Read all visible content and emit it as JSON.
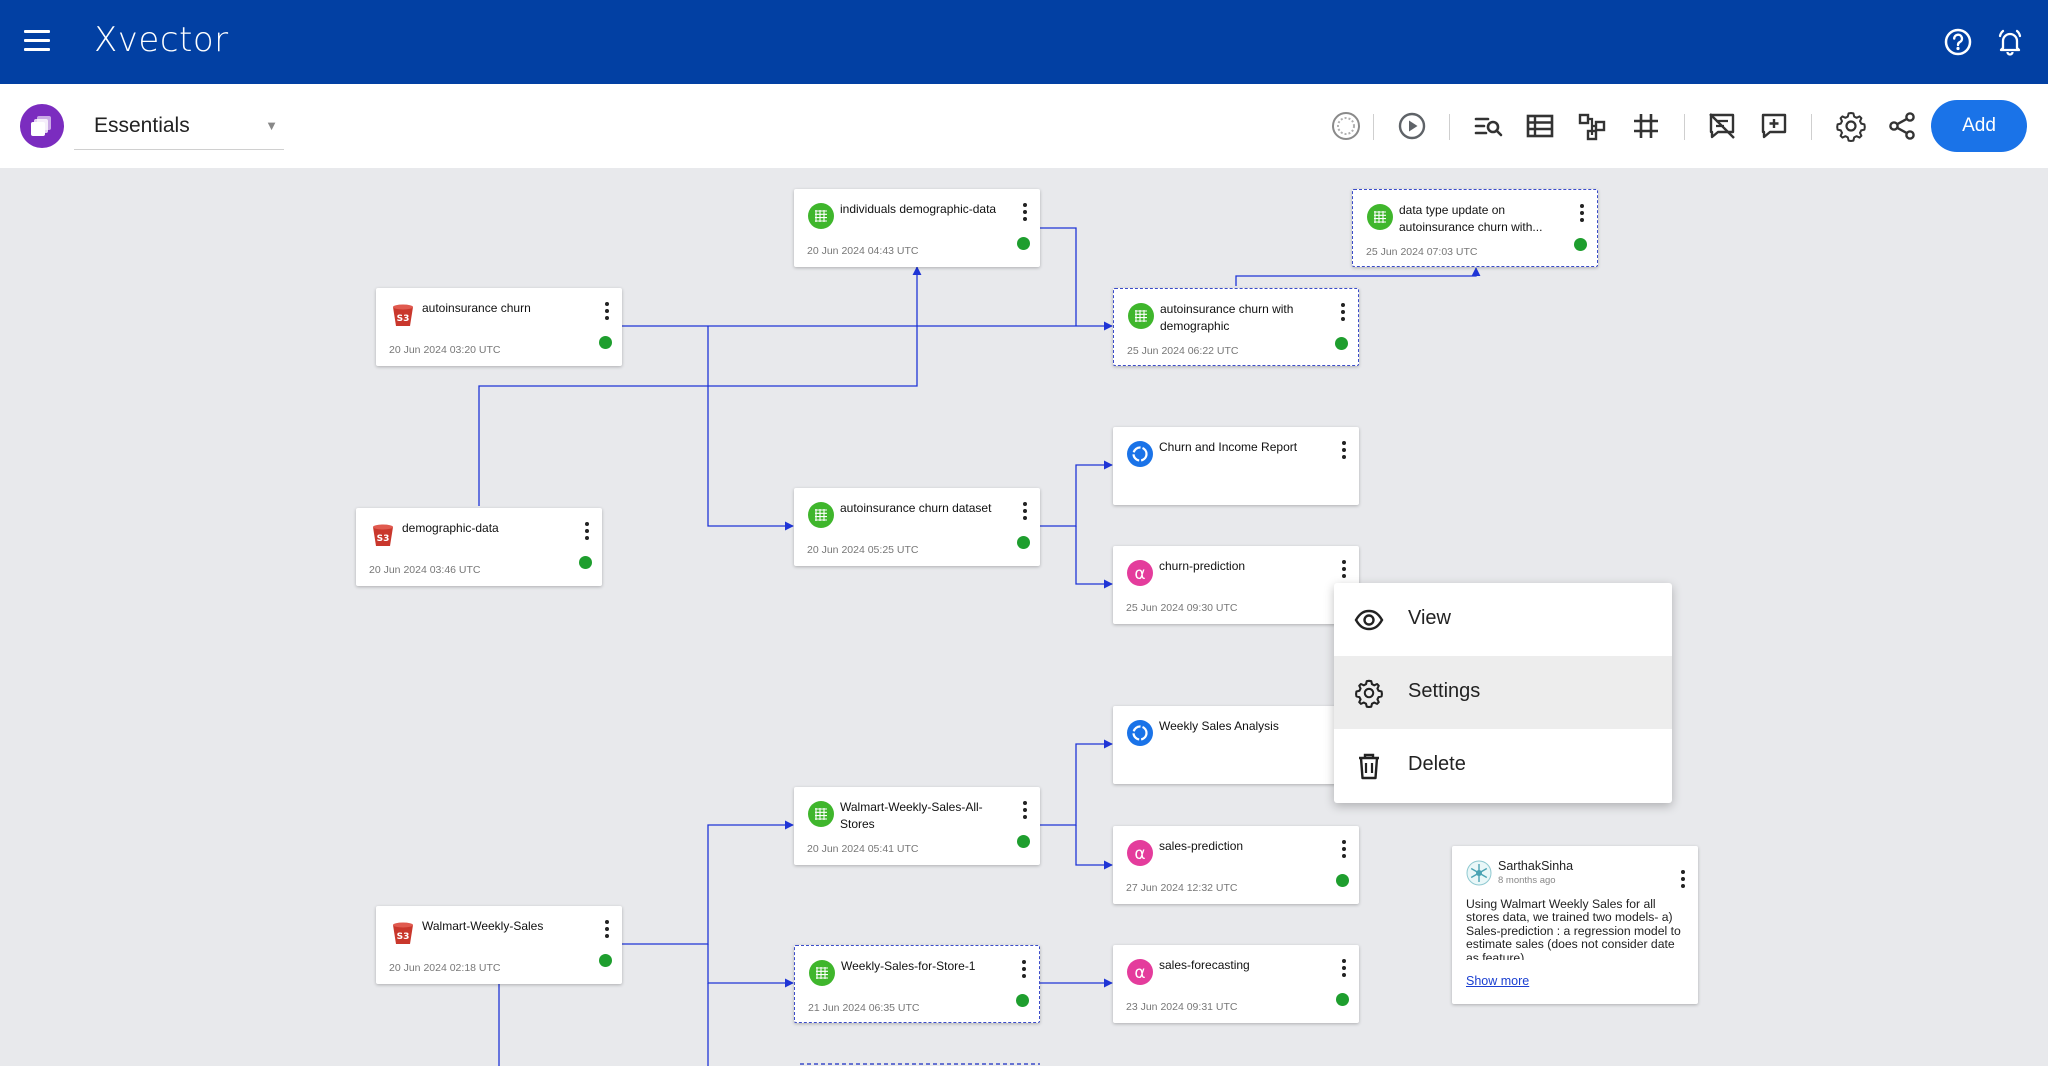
{
  "app": {
    "brand": "Xvector"
  },
  "project": {
    "name": "Essentials"
  },
  "toolbar": {
    "add_label": "Add"
  },
  "nodes": {
    "autoinsurance_churn": {
      "title": "autoinsurance churn",
      "date": "20 Jun 2024 03:20 UTC",
      "type": "s3"
    },
    "demographic_data": {
      "title": "demographic-data",
      "date": "20 Jun 2024 03:46 UTC",
      "type": "s3"
    },
    "individuals_demographic": {
      "title": "individuals demographic-data",
      "date": "20 Jun 2024 04:43 UTC",
      "type": "dataset"
    },
    "autoinsurance_churn_dataset": {
      "title": "autoinsurance churn dataset",
      "date": "20 Jun 2024 05:25 UTC",
      "type": "dataset"
    },
    "churn_with_demographic": {
      "title": "autoinsurance churn with demographic",
      "date": "25 Jun 2024 06:22 UTC",
      "type": "dataset"
    },
    "data_type_update": {
      "title": "data type update on autoinsurance churn with...",
      "date": "25 Jun 2024 07:03 UTC",
      "type": "dataset"
    },
    "churn_income_report": {
      "title": "Churn and Income Report",
      "date": "",
      "type": "report"
    },
    "churn_prediction": {
      "title": "churn-prediction",
      "date": "25 Jun 2024 09:30 UTC",
      "type": "model"
    },
    "weekly_sales_analysis": {
      "title": "Weekly Sales Analysis",
      "date": "",
      "type": "report"
    },
    "walmart_all_stores": {
      "title": "Walmart-Weekly-Sales-All-Stores",
      "date": "20 Jun 2024 05:41 UTC",
      "type": "dataset"
    },
    "sales_prediction": {
      "title": "sales-prediction",
      "date": "27 Jun 2024 12:32 UTC",
      "type": "model"
    },
    "walmart_weekly_sales": {
      "title": "Walmart-Weekly-Sales",
      "date": "20 Jun 2024 02:18 UTC",
      "type": "s3"
    },
    "weekly_sales_store1": {
      "title": "Weekly-Sales-for-Store-1",
      "date": "21 Jun 2024 06:35 UTC",
      "type": "dataset"
    },
    "sales_forecasting": {
      "title": "sales-forecasting",
      "date": "23 Jun 2024 09:31 UTC",
      "type": "model"
    }
  },
  "context_menu": {
    "view": "View",
    "settings": "Settings",
    "delete": "Delete"
  },
  "comment": {
    "user": "SarthakSinha",
    "time": "8 months ago",
    "body": "Using Walmart Weekly Sales for all stores data, we trained two models- a) Sales-prediction : a regression model to estimate sales (does not consider date as feature)",
    "show_more": "Show more"
  },
  "colors": {
    "header": "#0240a3",
    "accent": "#1a73e8",
    "wire": "#1f35d6",
    "status": "#1e9e2e",
    "s3": "#c9372c",
    "dataset": "#3fb62c",
    "report": "#1a73e8",
    "model": "#e43c9c"
  }
}
